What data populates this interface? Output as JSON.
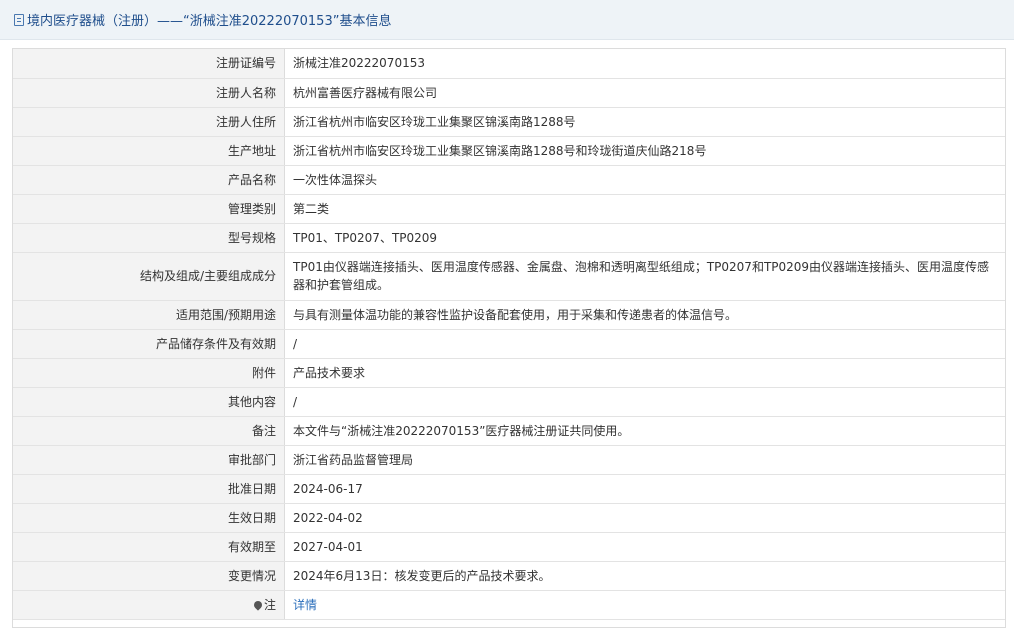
{
  "header": {
    "title": "境内医疗器械（注册）——“浙械注准20222070153”基本信息"
  },
  "rows": [
    {
      "label": "注册证编号",
      "value": "浙械注准20222070153"
    },
    {
      "label": "注册人名称",
      "value": "杭州富善医疗器械有限公司"
    },
    {
      "label": "注册人住所",
      "value": "浙江省杭州市临安区玲珑工业集聚区锦溪南路1288号"
    },
    {
      "label": "生产地址",
      "value": "浙江省杭州市临安区玲珑工业集聚区锦溪南路1288号和玲珑街道庆仙路218号"
    },
    {
      "label": "产品名称",
      "value": "一次性体温探头"
    },
    {
      "label": "管理类别",
      "value": "第二类"
    },
    {
      "label": "型号规格",
      "value": "TP01、TP0207、TP0209"
    },
    {
      "label": "结构及组成/主要组成成分",
      "value": "TP01由仪器端连接插头、医用温度传感器、金属盘、泡棉和透明离型纸组成；TP0207和TP0209由仪器端连接插头、医用温度传感器和护套管组成。"
    },
    {
      "label": "适用范围/预期用途",
      "value": "与具有测量体温功能的兼容性监护设备配套使用，用于采集和传递患者的体温信号。"
    },
    {
      "label": "产品储存条件及有效期",
      "value": "/"
    },
    {
      "label": "附件",
      "value": "产品技术要求"
    },
    {
      "label": "其他内容",
      "value": "/"
    },
    {
      "label": "备注",
      "value": "本文件与“浙械注准20222070153”医疗器械注册证共同使用。"
    },
    {
      "label": "审批部门",
      "value": "浙江省药品监督管理局"
    },
    {
      "label": "批准日期",
      "value": "2024-06-17"
    },
    {
      "label": "生效日期",
      "value": "2022-04-02"
    },
    {
      "label": "有效期至",
      "value": "2027-04-01"
    },
    {
      "label": "变更情况",
      "value": "2024年6月13日：核发变更后的产品技术要求。"
    }
  ],
  "note": {
    "icon": "pin-icon",
    "label": "注",
    "link": "详情"
  }
}
